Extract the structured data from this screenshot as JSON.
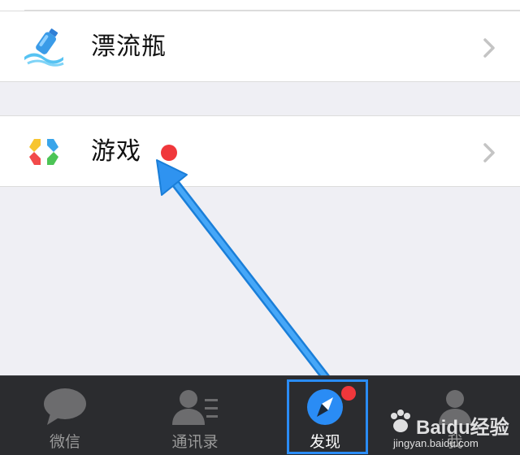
{
  "discover_list": {
    "items": [
      {
        "label": "漂流瓶",
        "icon": "drift-bottle-icon"
      },
      {
        "label": "游戏",
        "icon": "game-icon",
        "has_new_dot": true
      }
    ]
  },
  "tabbar": {
    "tabs": [
      {
        "label": "微信",
        "icon": "chat-bubble-icon"
      },
      {
        "label": "通讯录",
        "icon": "contacts-icon"
      },
      {
        "label": "发现",
        "icon": "compass-icon",
        "active": true,
        "has_badge": true
      },
      {
        "label": "我",
        "icon": "profile-icon"
      }
    ]
  },
  "watermark": {
    "text": "Baidu经验",
    "url": "jingyan.baidu.com"
  },
  "colors": {
    "accent_blue": "#2a8cf5",
    "badge_red": "#f0373b",
    "tabbar_bg": "#2b2c2f",
    "page_bg": "#efeff4"
  }
}
